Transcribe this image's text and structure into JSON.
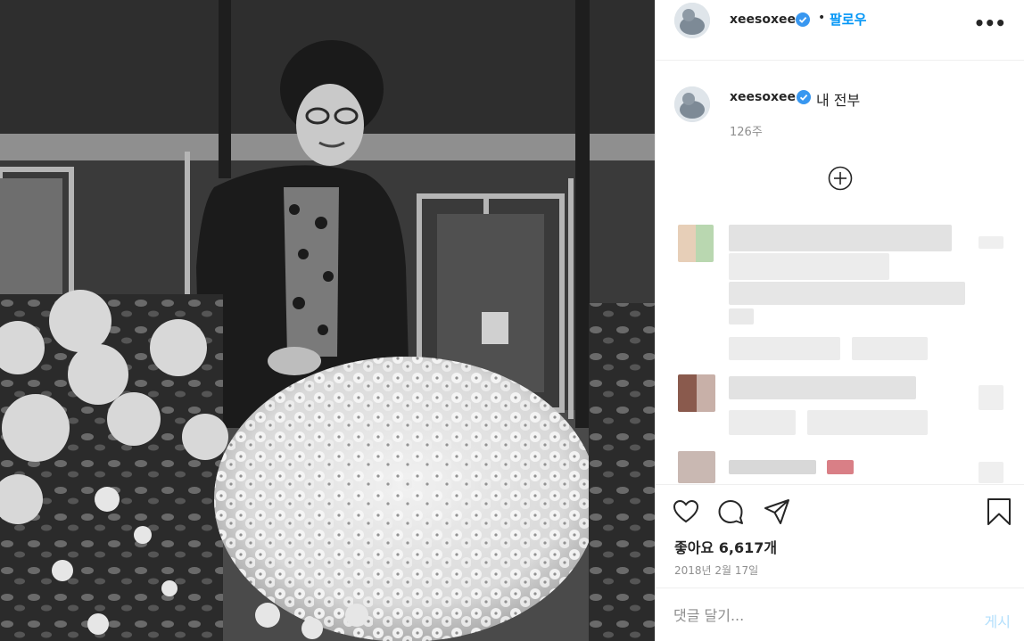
{
  "post": {
    "username": "xeesoxee",
    "follow_label": "팔로우",
    "dot": "•",
    "more": "•••",
    "caption": "내 전부",
    "caption_age": "126주",
    "likes_text": "좋아요 6,617개",
    "date_text": "2018년 2월 17일",
    "comment_placeholder": "댓글 달기...",
    "post_button_label": "게시"
  },
  "photo": {
    "description_tag": "black-and-white photo of woman with chrysanthemums"
  },
  "colors": {
    "accent": "#0095f6",
    "verified": "#3897f0",
    "muted": "#8e8e8e",
    "text": "#262626"
  },
  "icons": {
    "like": "heart-icon",
    "comment": "comment-icon",
    "share": "paper-plane-icon",
    "save": "bookmark-icon",
    "load_more": "plus-circle-icon",
    "verified": "verified-badge-icon"
  }
}
